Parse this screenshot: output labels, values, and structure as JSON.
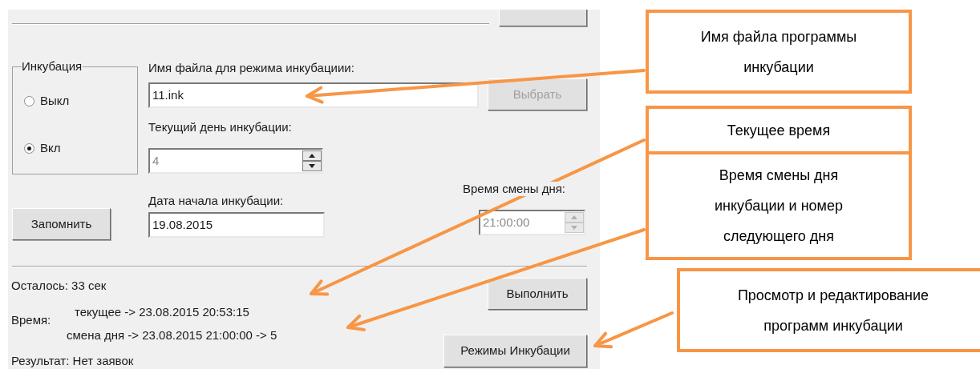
{
  "dialog": {
    "incubation_group": {
      "title": "Инкубация",
      "options": [
        {
          "label": "Выкл",
          "selected": false
        },
        {
          "label": "Вкл",
          "selected": true
        }
      ]
    },
    "file_name": {
      "label": "Имя файла для режима инкубациии:",
      "value": "11.ink"
    },
    "choose_button": {
      "label": "Выбрать",
      "disabled": true
    },
    "current_day": {
      "label": "Текущий день инкубации:",
      "value": "4",
      "disabled": true
    },
    "start_date": {
      "label": "Дата начала инкубации:",
      "value": "19.08.2015"
    },
    "save_button": {
      "label": "Запомнить"
    },
    "day_change_time": {
      "label": "Время смены дня:",
      "value": "21:00:00",
      "disabled": true
    },
    "remaining": {
      "label": "Осталось:",
      "value": "33 сек"
    },
    "run_button": {
      "label": "Выполнить"
    },
    "time": {
      "label": "Время:",
      "current": "текущее ->  23.08.2015 20:53:15",
      "day_change": "смена дня ->  23.08.2015 21:00:00 -> 5"
    },
    "result": {
      "label": "Результат:",
      "value": "Нет заявок"
    },
    "modes_button": {
      "label": "Режимы Инкубации"
    }
  },
  "callouts": [
    {
      "lines": [
        "Имя файла программы",
        "инкубации"
      ]
    },
    {
      "lines": [
        "Текущее время"
      ]
    },
    {
      "lines": [
        "Время смены дня",
        "инкубации и номер",
        "следующего дня"
      ]
    },
    {
      "lines": [
        "Просмотр  и редактирование",
        "программ инкубации"
      ]
    }
  ]
}
